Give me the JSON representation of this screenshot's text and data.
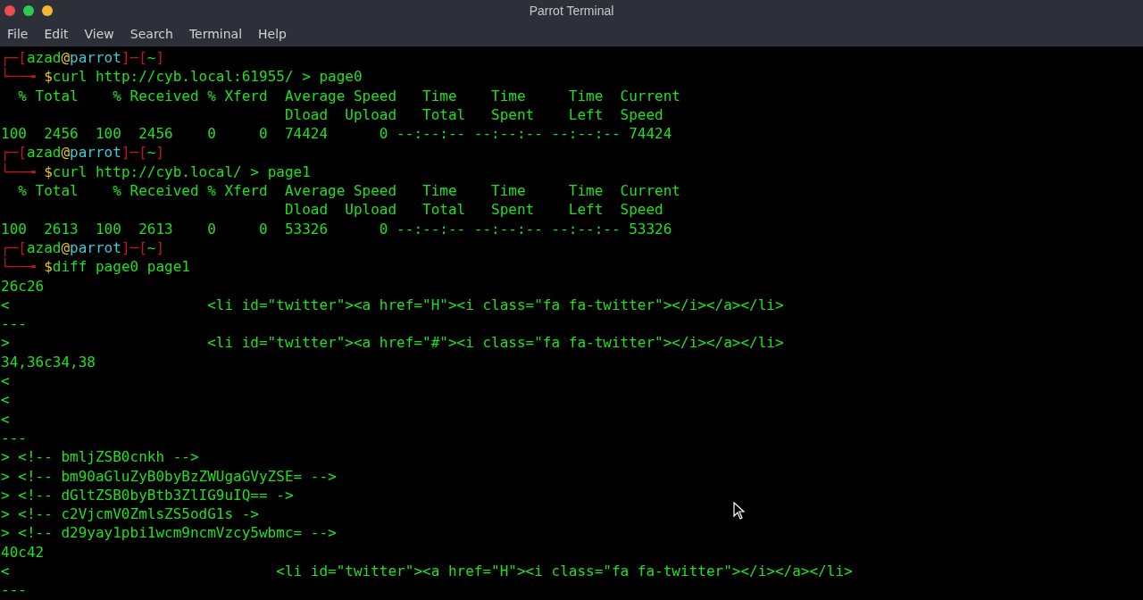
{
  "window": {
    "title": "Parrot Terminal"
  },
  "menu": [
    "File",
    "Edit",
    "View",
    "Search",
    "Terminal",
    "Help"
  ],
  "terminal": {
    "lines": [
      {
        "kind": "prompt",
        "open": "┌─[",
        "user": "azad",
        "at": "@",
        "host": "parrot",
        "mid": "]─[",
        "dir": "~",
        "close": "]",
        "corner": "└──╼ ",
        "symbol": "$",
        "command": "curl http://cyb.local:61955/ > page0"
      },
      {
        "kind": "text",
        "text": "  % Total    % Received % Xferd  Average Speed   Time    Time     Time  Current"
      },
      {
        "kind": "text",
        "text": "                                 Dload  Upload   Total   Spent    Left  Speed"
      },
      {
        "kind": "text",
        "text": "100  2456  100  2456    0     0  74424      0 --:--:-- --:--:-- --:--:-- 74424"
      },
      {
        "kind": "prompt",
        "open": "┌─[",
        "user": "azad",
        "at": "@",
        "host": "parrot",
        "mid": "]─[",
        "dir": "~",
        "close": "]",
        "corner": "└──╼ ",
        "symbol": "$",
        "command": "curl http://cyb.local/ > page1"
      },
      {
        "kind": "text",
        "text": "  % Total    % Received % Xferd  Average Speed   Time    Time     Time  Current"
      },
      {
        "kind": "text",
        "text": "                                 Dload  Upload   Total   Spent    Left  Speed"
      },
      {
        "kind": "text",
        "text": "100  2613  100  2613    0     0  53326      0 --:--:-- --:--:-- --:--:-- 53326"
      },
      {
        "kind": "prompt",
        "open": "┌─[",
        "user": "azad",
        "at": "@",
        "host": "parrot",
        "mid": "]─[",
        "dir": "~",
        "close": "]",
        "corner": "└──╼ ",
        "symbol": "$",
        "command": "diff page0 page1"
      },
      {
        "kind": "text",
        "text": "26c26"
      },
      {
        "kind": "text",
        "text": "<                       <li id=\"twitter\"><a href=\"H\"><i class=\"fa fa-twitter\"></i></a></li>"
      },
      {
        "kind": "text",
        "text": "---"
      },
      {
        "kind": "text",
        "text": ">                       <li id=\"twitter\"><a href=\"#\"><i class=\"fa fa-twitter\"></i></a></li>"
      },
      {
        "kind": "text",
        "text": "34,36c34,38"
      },
      {
        "kind": "text",
        "text": "<"
      },
      {
        "kind": "text",
        "text": "<"
      },
      {
        "kind": "text",
        "text": "<"
      },
      {
        "kind": "text",
        "text": "---"
      },
      {
        "kind": "text",
        "text": "> <!-- bmljZSB0cnkh -->"
      },
      {
        "kind": "text",
        "text": "> <!-- bm90aGluZyB0byBzZWUgaGVyZSE= -->"
      },
      {
        "kind": "text",
        "text": "> <!-- dGltZSB0byBtb3ZlIG9uIQ== ->"
      },
      {
        "kind": "text",
        "text": "> <!-- c2VjcmV0ZmlsZS5odG1s ->"
      },
      {
        "kind": "text",
        "text": "> <!-- d29yay1pbi1wcm9ncmVzcy5wbmc= -->"
      },
      {
        "kind": "text",
        "text": "40c42"
      },
      {
        "kind": "text",
        "text": "<                               <li id=\"twitter\"><a href=\"H\"><i class=\"fa fa-twitter\"></i></a></li>"
      },
      {
        "kind": "text",
        "text": "---"
      }
    ]
  }
}
